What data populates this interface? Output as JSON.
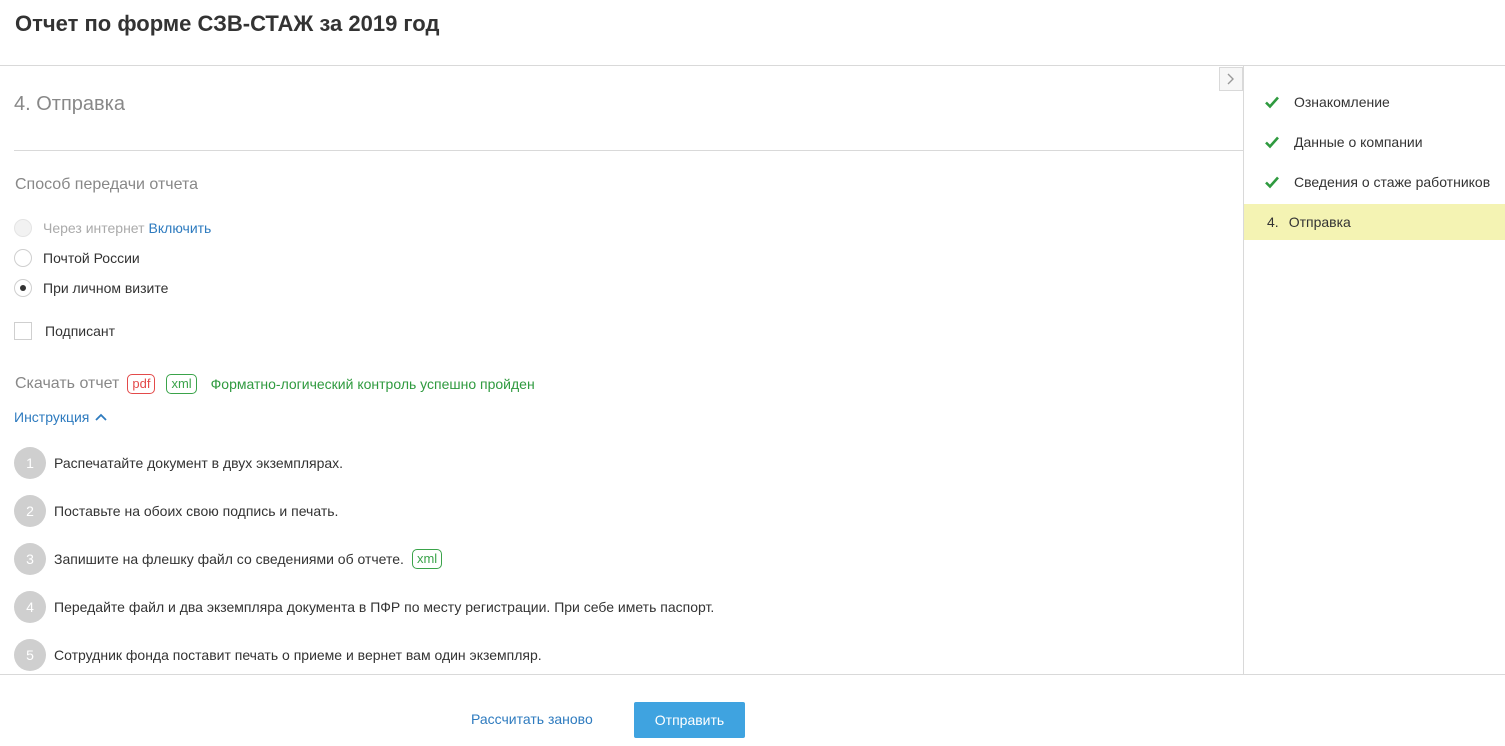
{
  "header": {
    "title": "Отчет по форме СЗВ-СТАЖ за 2019 год"
  },
  "step": {
    "heading": "4. Отправка"
  },
  "delivery": {
    "label": "Способ передачи отчета",
    "options": [
      {
        "label": "Через интернет",
        "link": "Включить",
        "state": "disabled"
      },
      {
        "label": "Почтой России",
        "state": "unchecked"
      },
      {
        "label": "При личном визите",
        "state": "checked"
      }
    ]
  },
  "signer": {
    "label": "Подписант",
    "checked": false
  },
  "download": {
    "label": "Скачать отчет",
    "pdf": "pdf",
    "xml": "xml",
    "status": "Форматно-логический контроль успешно пройден"
  },
  "instruction": {
    "toggle_label": "Инструкция",
    "steps": [
      {
        "num": "1",
        "text": "Распечатайте документ в двух экземплярах."
      },
      {
        "num": "2",
        "text": "Поставьте на обоих свою подпись и печать."
      },
      {
        "num": "3",
        "text": "Запишите на флешку файл со сведениями об отчете.",
        "tag": "xml"
      },
      {
        "num": "4",
        "text": "Передайте файл и два экземпляра документа в ПФР по месту регистрации. При себе иметь паспорт."
      },
      {
        "num": "5",
        "text": "Сотрудник фонда поставит печать о приеме и вернет вам один экземпляр."
      }
    ]
  },
  "sidebar": {
    "items": [
      {
        "label": "Ознакомление",
        "status": "done"
      },
      {
        "label": "Данные о компании",
        "status": "done"
      },
      {
        "label": "Сведения о стаже работников",
        "status": "done"
      },
      {
        "num": "4.",
        "label": "Отправка",
        "status": "active"
      }
    ]
  },
  "footer": {
    "recalc_label": "Рассчитать заново",
    "send_label": "Отправить"
  },
  "colors": {
    "accent_blue": "#3fa3e0",
    "link_blue": "#2e7bbf",
    "success_green": "#2f9a3f",
    "pdf_red": "#e34a4a",
    "active_step_bg": "#f4f3b3"
  }
}
